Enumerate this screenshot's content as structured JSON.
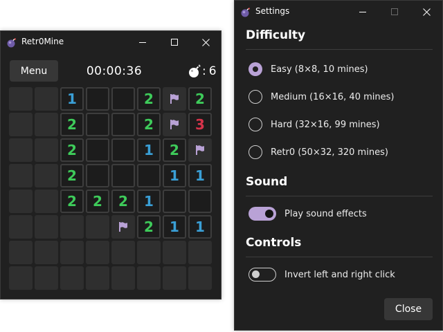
{
  "colors": {
    "window_bg": "#202020",
    "hidden_cell": "#2f2f2f",
    "revealed_cell": "#1c1c1c",
    "accent": "#b9a2d6",
    "n1": "#3a9fd6",
    "n2": "#3ecb5a",
    "n3": "#d6334a",
    "flag": "#b9a2d6"
  },
  "game": {
    "title": "Retr0Mine",
    "menu_label": "Menu",
    "timer": "00:00:36",
    "mine_separator": ":",
    "mine_count": "6",
    "mine_icon": "bomb-icon",
    "board": [
      [
        "H",
        "H",
        "1",
        "0",
        "0",
        "2",
        "F",
        "2"
      ],
      [
        "H",
        "H",
        "2",
        "0",
        "0",
        "2",
        "F",
        "3"
      ],
      [
        "H",
        "H",
        "2",
        "0",
        "0",
        "1",
        "2",
        "F"
      ],
      [
        "H",
        "H",
        "2",
        "0",
        "0",
        "0",
        "1",
        "1"
      ],
      [
        "H",
        "H",
        "2",
        "2",
        "2",
        "1",
        "0",
        "0"
      ],
      [
        "H",
        "H",
        "H",
        "H",
        "F",
        "2",
        "1",
        "1"
      ],
      [
        "H",
        "H",
        "H",
        "H",
        "H",
        "H",
        "H",
        "H"
      ],
      [
        "H",
        "H",
        "H",
        "H",
        "H",
        "H",
        "H",
        "H"
      ]
    ]
  },
  "settings": {
    "title": "Settings",
    "difficulty": {
      "heading": "Difficulty",
      "options": [
        {
          "label": "Easy (8×8, 10 mines)",
          "checked": true
        },
        {
          "label": "Medium (16×16, 40 mines)",
          "checked": false
        },
        {
          "label": "Hard (32×16, 99 mines)",
          "checked": false
        },
        {
          "label": "Retr0 (50×32, 320 mines)",
          "checked": false
        }
      ]
    },
    "sound": {
      "heading": "Sound",
      "toggle_label": "Play sound effects",
      "on": true
    },
    "controls": {
      "heading": "Controls",
      "toggle_label": "Invert left and right click",
      "on": false
    },
    "close_label": "Close"
  }
}
